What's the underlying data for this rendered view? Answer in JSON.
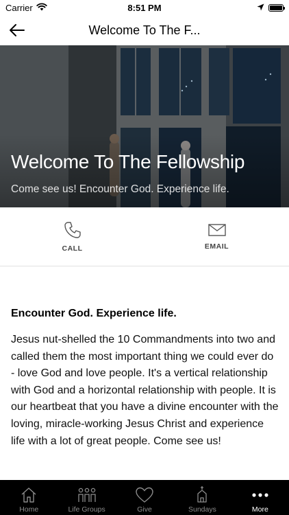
{
  "status_bar": {
    "carrier": "Carrier",
    "time": "8:51 PM"
  },
  "nav": {
    "title": "Welcome To The F..."
  },
  "hero": {
    "title": "Welcome To The Fellowship",
    "subtitle": "Come see us!  Encounter God.  Experience life."
  },
  "actions": [
    {
      "label": "CALL",
      "icon": "phone-icon"
    },
    {
      "label": "EMAIL",
      "icon": "envelope-icon"
    }
  ],
  "content": {
    "heading": "Encounter God. Experience life.",
    "body": "Jesus nut-shelled the 10 Commandments into two and called them the most important thing we could ever do - love God and love people.  It's a vertical relationship with God and a horizontal relationship with people.  It is our heartbeat that you have a divine encounter with the loving, miracle-working Jesus Christ and experience life with a lot of great people. Come see us!"
  },
  "tabs": [
    {
      "label": "Home",
      "icon": "home-icon"
    },
    {
      "label": "Life Groups",
      "icon": "people-icon"
    },
    {
      "label": "Give",
      "icon": "heart-icon"
    },
    {
      "label": "Sundays",
      "icon": "church-icon"
    },
    {
      "label": "More",
      "icon": "more-icon",
      "active": true
    }
  ]
}
